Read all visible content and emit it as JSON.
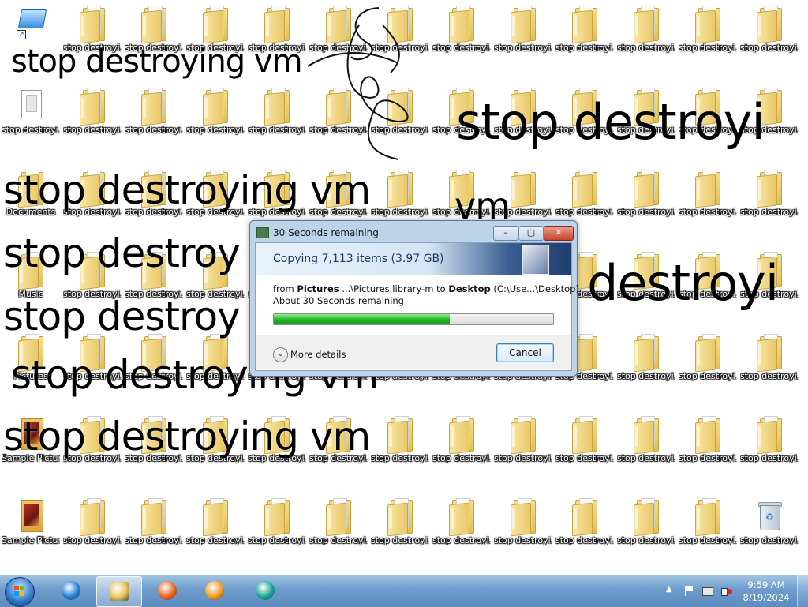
{
  "desktop": {
    "col_x": [
      0,
      78,
      156,
      234,
      312,
      390,
      468,
      546,
      624,
      702,
      780,
      858,
      936
    ],
    "row_y": [
      0,
      104,
      208,
      312,
      416,
      520,
      624
    ],
    "folder_label": "stop destroyi...",
    "special_icons": [
      {
        "row": 0,
        "col": 0,
        "kind": "shortcut",
        "label": "",
        "name": "shortcut-icon"
      },
      {
        "row": 1,
        "col": 0,
        "kind": "doc",
        "label": "stop destroyi...",
        "name": "document-file-icon"
      },
      {
        "row": 2,
        "col": 0,
        "kind": "folder",
        "label": "Documents",
        "name": "folder-icon"
      },
      {
        "row": 3,
        "col": 0,
        "kind": "folder",
        "label": "Music",
        "name": "folder-icon"
      },
      {
        "row": 4,
        "col": 0,
        "kind": "folder",
        "label": "Pictures",
        "name": "folder-icon"
      },
      {
        "row": 5,
        "col": 0,
        "kind": "sample",
        "label": "Sample Pictures",
        "name": "sample-pictures-icon"
      },
      {
        "row": 6,
        "col": 0,
        "kind": "sample",
        "label": "Sample Pictures",
        "name": "sample-pictures-icon"
      },
      {
        "row": 6,
        "col": 12,
        "kind": "recycle",
        "label": "stop destroyi...",
        "name": "recycle-bin-icon"
      }
    ],
    "graffiti": [
      "stop destroying vm",
      "stop destroyi",
      "stop destroying vm",
      "vm",
      "stop destroy",
      "destroyi",
      "stop destroy",
      "stop destroying vm",
      "stop destroying vm"
    ]
  },
  "dialog": {
    "title": "30 Seconds remaining",
    "min_glyph": "–",
    "max_glyph": "▢",
    "close_glyph": "✕",
    "heading": "Copying 7,113 items (3.97 GB)",
    "from_word": "from",
    "source_name": "Pictures",
    "source_path": " ...\\Pictures.library-m",
    "to_word": " to ",
    "dest_name": "Desktop",
    "dest_path": " (C:\\Use...\\Desktop)",
    "remaining": "About 30 Seconds remaining",
    "progress": 0.63,
    "more_details": "More details",
    "more_glyph": "⌄",
    "cancel": "Cancel"
  },
  "taskbar": {
    "apps": [
      {
        "name": "internet-explorer-icon",
        "active": false,
        "color": "#1e7fd6"
      },
      {
        "name": "file-explorer-icon",
        "active": true,
        "color": "#e8c65a"
      },
      {
        "name": "firefox-icon",
        "active": false,
        "color": "#e8651e"
      },
      {
        "name": "media-player-icon",
        "active": false,
        "color": "#f39a1e"
      },
      {
        "name": "app-icon",
        "active": false,
        "color": "#19a59a"
      }
    ],
    "show_hidden_glyph": "▲",
    "time": "9:59 AM",
    "date": "8/19/2024"
  }
}
